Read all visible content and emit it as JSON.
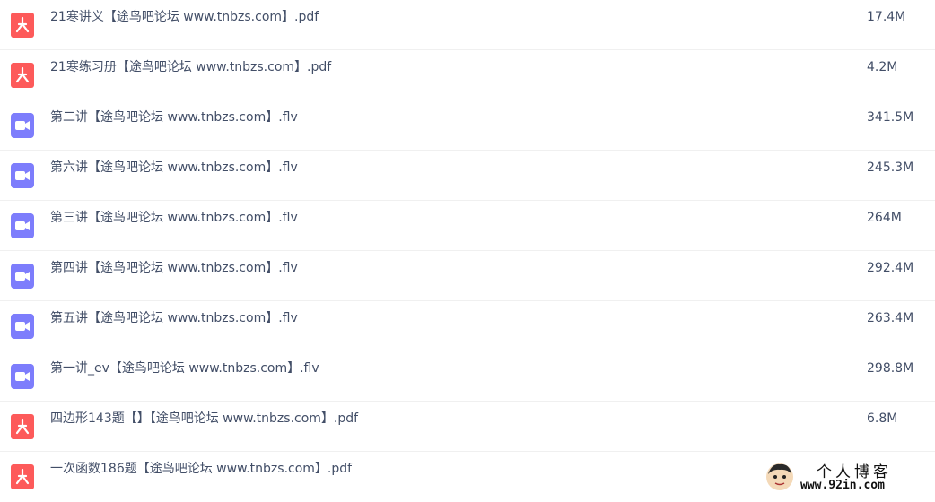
{
  "colors": {
    "pdf_icon": "#fd5a5a",
    "video_icon": "#7d7dfc",
    "text": "#424e67",
    "divider": "#f0f0f0"
  },
  "files": [
    {
      "name": "21寒讲义【途鸟吧论坛 www.tnbzs.com】.pdf",
      "size": "17.4M",
      "icon": "pdf-icon"
    },
    {
      "name": "21寒练习册【途鸟吧论坛 www.tnbzs.com】.pdf",
      "size": "4.2M",
      "icon": "pdf-icon"
    },
    {
      "name": "第二讲【途鸟吧论坛 www.tnbzs.com】.flv",
      "size": "341.5M",
      "icon": "video-icon"
    },
    {
      "name": "第六讲【途鸟吧论坛 www.tnbzs.com】.flv",
      "size": "245.3M",
      "icon": "video-icon"
    },
    {
      "name": "第三讲【途鸟吧论坛 www.tnbzs.com】.flv",
      "size": "264M",
      "icon": "video-icon"
    },
    {
      "name": "第四讲【途鸟吧论坛 www.tnbzs.com】.flv",
      "size": "292.4M",
      "icon": "video-icon"
    },
    {
      "name": "第五讲【途鸟吧论坛 www.tnbzs.com】.flv",
      "size": "263.4M",
      "icon": "video-icon"
    },
    {
      "name": "第一讲_ev【途鸟吧论坛 www.tnbzs.com】.flv",
      "size": "298.8M",
      "icon": "video-icon"
    },
    {
      "name": "四边形143题【】【途鸟吧论坛 www.tnbzs.com】.pdf",
      "size": "6.8M",
      "icon": "pdf-icon"
    },
    {
      "name": "一次函数186题【途鸟吧论坛 www.tnbzs.com】.pdf",
      "size": "",
      "icon": "pdf-icon"
    }
  ],
  "watermark": {
    "title": "个人博客",
    "url": "www.92in.com"
  }
}
